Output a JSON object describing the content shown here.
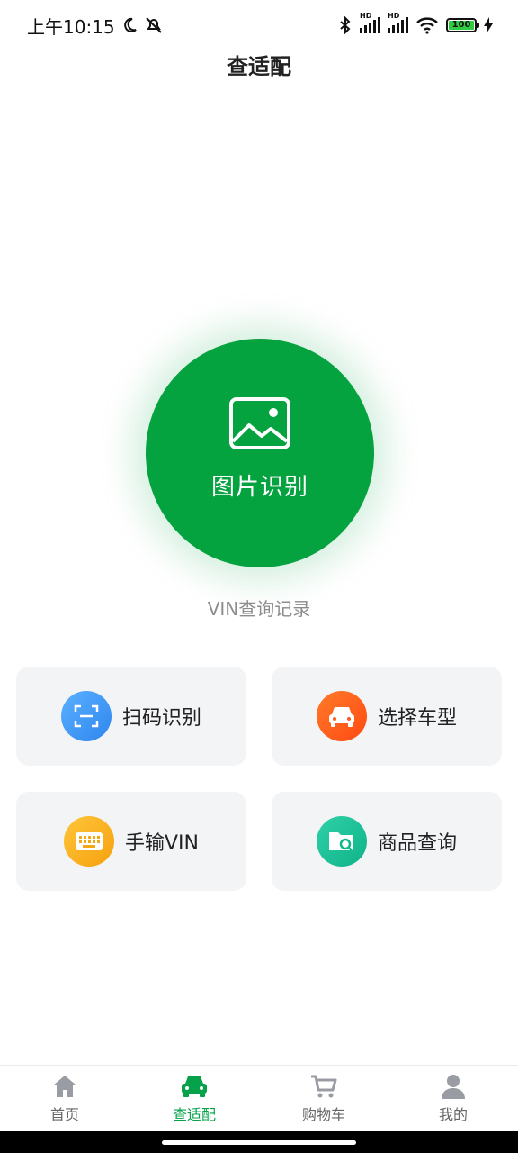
{
  "status_bar": {
    "time": "上午10:15",
    "battery": "100"
  },
  "header": {
    "title": "查适配"
  },
  "main": {
    "recognize_label": "图片识别",
    "vin_history_link": "VIN查询记录"
  },
  "actions": [
    {
      "label": "扫码识别",
      "icon": "scan-icon",
      "color": "#3d9cf5"
    },
    {
      "label": "选择车型",
      "icon": "car-icon",
      "color": "#ff5a1f"
    },
    {
      "label": "手输VIN",
      "icon": "keyboard-icon",
      "color": "#f7b11f"
    },
    {
      "label": "商品查询",
      "icon": "folder-search-icon",
      "color": "#17c09a"
    }
  ],
  "bottom_nav": {
    "items": [
      {
        "label": "首页",
        "icon": "home-icon"
      },
      {
        "label": "查适配",
        "icon": "car-icon",
        "active": true
      },
      {
        "label": "购物车",
        "icon": "cart-icon"
      },
      {
        "label": "我的",
        "icon": "user-icon"
      }
    ]
  },
  "colors": {
    "brand": "#05a240",
    "inactive": "#999999"
  }
}
